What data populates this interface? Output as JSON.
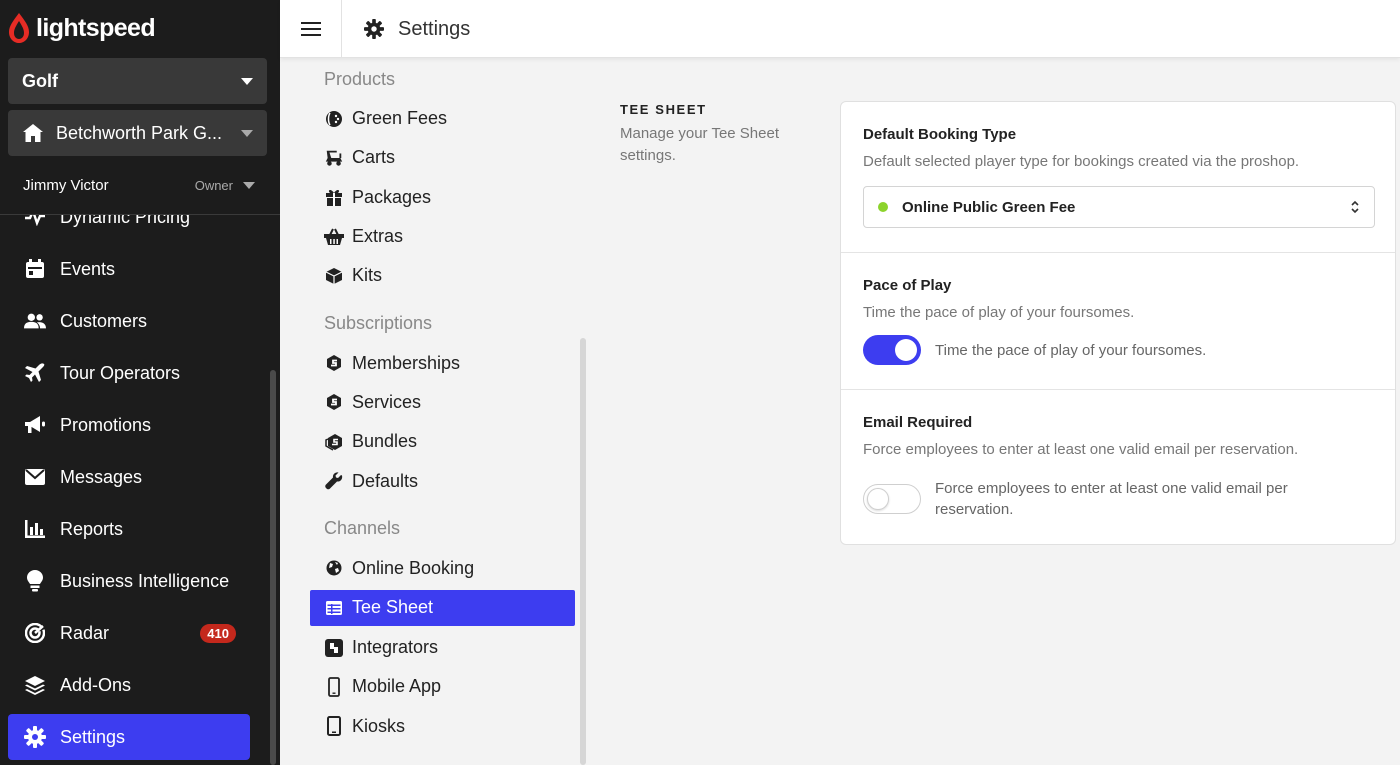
{
  "brand": {
    "name": "lightspeed",
    "color": "#e62c25"
  },
  "sidebar": {
    "app_selector": "Golf",
    "location_selector": "Betchworth Park G...",
    "user": {
      "name": "Jimmy Victor",
      "role": "Owner"
    },
    "items": [
      {
        "label": "Dynamic Pricing",
        "icon": "pulse-icon"
      },
      {
        "label": "Events",
        "icon": "calendar-icon"
      },
      {
        "label": "Customers",
        "icon": "users-icon"
      },
      {
        "label": "Tour Operators",
        "icon": "plane-icon"
      },
      {
        "label": "Promotions",
        "icon": "megaphone-icon"
      },
      {
        "label": "Messages",
        "icon": "envelope-icon"
      },
      {
        "label": "Reports",
        "icon": "bar-chart-icon"
      },
      {
        "label": "Business Intelligence",
        "icon": "lightbulb-icon"
      },
      {
        "label": "Radar",
        "icon": "radar-icon",
        "badge": "410"
      },
      {
        "label": "Add-Ons",
        "icon": "layers-icon"
      },
      {
        "label": "Settings",
        "icon": "gear-icon",
        "active": true
      }
    ]
  },
  "header": {
    "title": "Settings"
  },
  "subnav": {
    "products": {
      "heading": "Products",
      "items": [
        "Green Fees",
        "Carts",
        "Packages",
        "Extras",
        "Kits"
      ]
    },
    "subscriptions": {
      "heading": "Subscriptions",
      "items": [
        "Memberships",
        "Services",
        "Bundles",
        "Defaults"
      ]
    },
    "channels": {
      "heading": "Channels",
      "items": [
        "Online Booking",
        "Tee Sheet",
        "Integrators",
        "Mobile App",
        "Kiosks"
      ],
      "active": "Tee Sheet"
    }
  },
  "section": {
    "title": "TEE SHEET",
    "description": "Manage your Tee Sheet settings."
  },
  "settings": {
    "default_booking": {
      "title": "Default Booking Type",
      "help": "Default selected player type for bookings created via the proshop.",
      "value": "Online Public Green Fee",
      "dot_color": "#8cd32c"
    },
    "pace_of_play": {
      "title": "Pace of Play",
      "help": "Time the pace of play of your foursomes.",
      "toggle_label": "Time the pace of play of your foursomes.",
      "enabled": true
    },
    "email_required": {
      "title": "Email Required",
      "help": "Force employees to enter at least one valid email per reservation.",
      "toggle_label": "Force employees to enter at least one valid email per reservation.",
      "enabled": false
    }
  },
  "colors": {
    "accent": "#3d3df0",
    "sidebar_bg": "#1c1c1c",
    "badge": "#c4281c"
  }
}
